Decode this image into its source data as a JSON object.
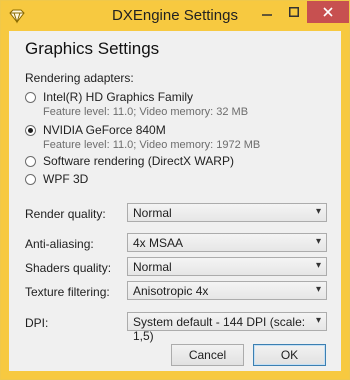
{
  "window": {
    "title": "DXEngine Settings"
  },
  "heading": "Graphics Settings",
  "adapters": {
    "label": "Rendering adapters:",
    "items": [
      {
        "label": "Intel(R) HD Graphics Family",
        "detail": "Feature level: 11.0; Video memory: 32 MB",
        "checked": false
      },
      {
        "label": "NVIDIA GeForce 840M",
        "detail": "Feature level: 11.0; Video memory: 1972 MB",
        "checked": true
      },
      {
        "label": "Software rendering (DirectX WARP)",
        "detail": "",
        "checked": false
      },
      {
        "label": "WPF 3D",
        "detail": "",
        "checked": false
      }
    ]
  },
  "settings": {
    "render_quality": {
      "label": "Render quality:",
      "value": "Normal"
    },
    "anti_aliasing": {
      "label": "Anti-aliasing:",
      "value": "4x MSAA"
    },
    "shaders_quality": {
      "label": "Shaders quality:",
      "value": "Normal"
    },
    "texture_filtering": {
      "label": "Texture filtering:",
      "value": "Anisotropic 4x"
    },
    "dpi": {
      "label": "DPI:",
      "value": "System default - 144 DPI (scale: 1,5)"
    }
  },
  "buttons": {
    "cancel": "Cancel",
    "ok": "OK"
  },
  "colors": {
    "title_bar": "#f7c940",
    "close_button": "#c75050",
    "client_bg": "#f0f0f0"
  },
  "icons": {
    "app": "diamond-icon",
    "minimize": "minimize-icon",
    "maximize": "maximize-icon",
    "close": "close-icon",
    "dropdown": "chevron-down-icon"
  }
}
